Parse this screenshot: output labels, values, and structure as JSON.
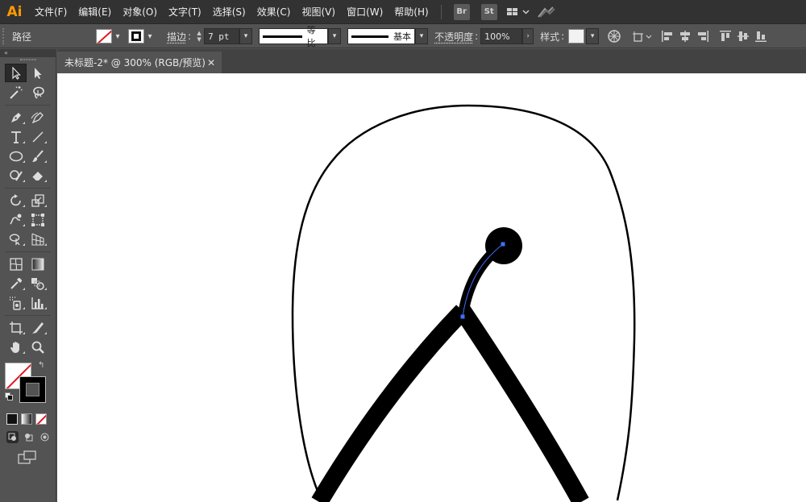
{
  "app": {
    "logo": "Ai"
  },
  "menubar": {
    "items": [
      {
        "label": "文件(F)"
      },
      {
        "label": "编辑(E)"
      },
      {
        "label": "对象(O)"
      },
      {
        "label": "文字(T)"
      },
      {
        "label": "选择(S)"
      },
      {
        "label": "效果(C)"
      },
      {
        "label": "视图(V)"
      },
      {
        "label": "窗口(W)"
      },
      {
        "label": "帮助(H)"
      }
    ],
    "bridge_label": "Br",
    "stock_label": "St",
    "workspace_icon": "workspace-switcher-icon",
    "gpu_icon": "gpu-performance-icon"
  },
  "control_bar": {
    "selection_type": "路径",
    "stroke_label": "描边",
    "stroke_weight": "7 pt",
    "variable_width_profile": "等比",
    "brush_definition": "基本",
    "opacity_label": "不透明度",
    "opacity_value": "100%",
    "style_label": "样式"
  },
  "document": {
    "tab_title": "未标题-2* @ 300% (RGB/预览)",
    "close_glyph": "✕"
  },
  "tools": {
    "collapse_glyph": "«",
    "swap_glyph": "↰"
  },
  "colors": {
    "app_bar": "#323232",
    "panel": "#535353",
    "logo": "#ff9a00",
    "none_slash": "#e0161f",
    "path_selection": "#3f6fff",
    "canvas": "#ffffff"
  }
}
